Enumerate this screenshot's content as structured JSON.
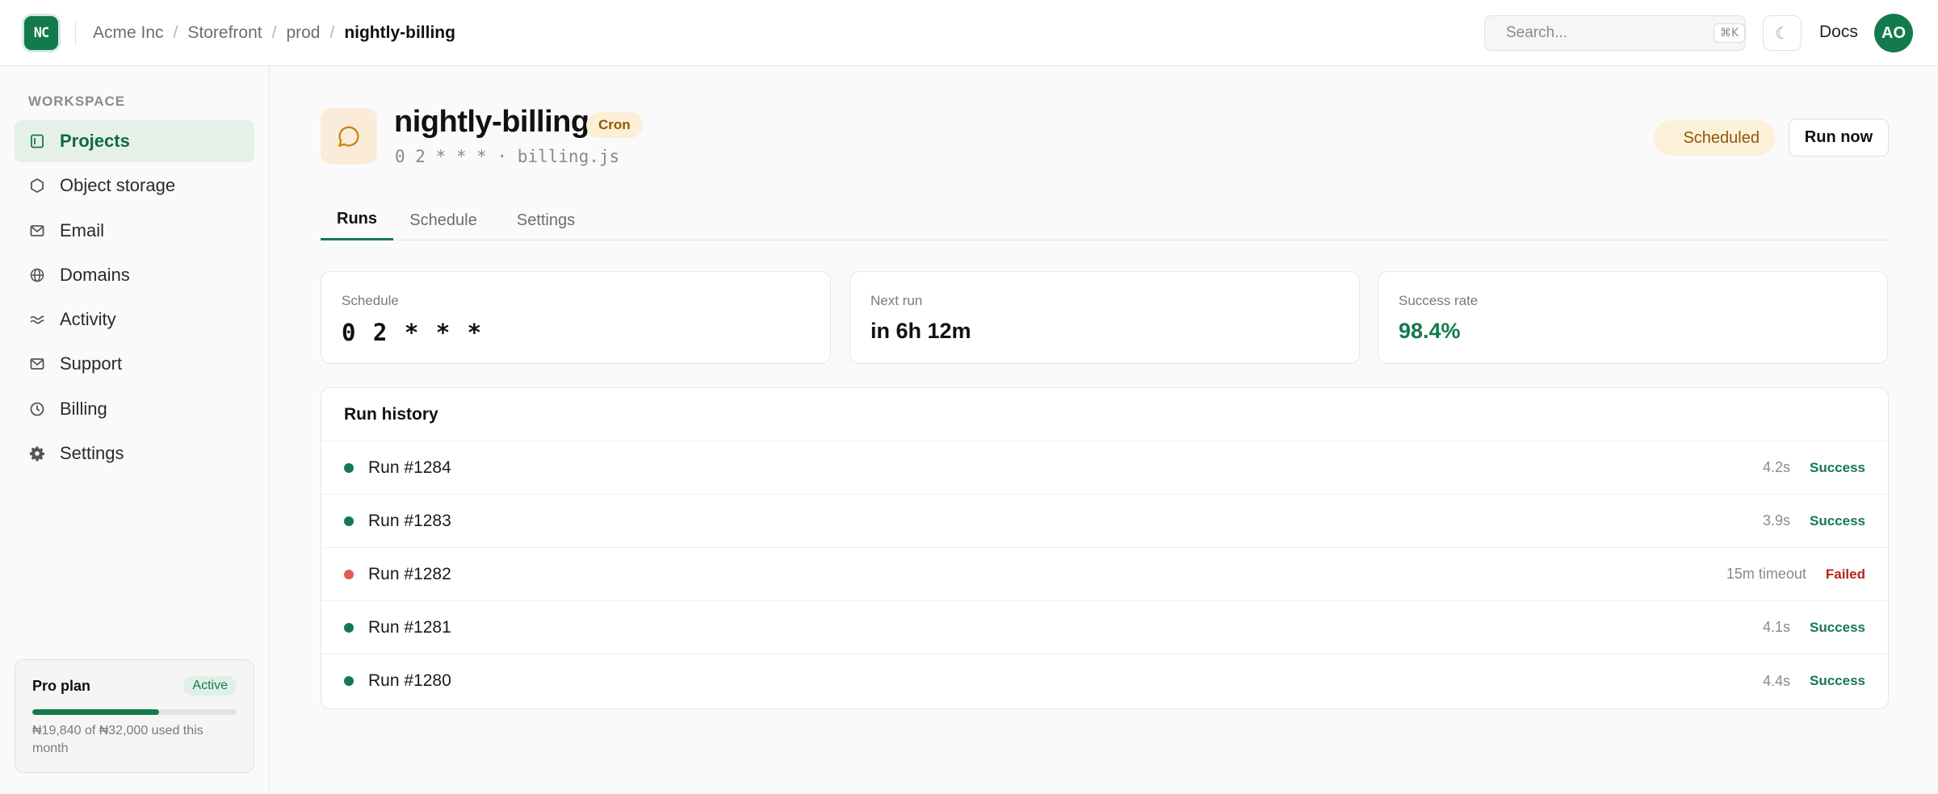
{
  "app": {
    "logo_text": "NC",
    "breadcrumb": [
      "Acme Inc",
      "Storefront",
      "prod"
    ],
    "breadcrumb_current": "nightly-billing",
    "search_placeholder": "Search...",
    "search_shortcut": "⌘K",
    "theme_icon": "☾",
    "docs_label": "Docs",
    "avatar_initials": "AO"
  },
  "sidebar": {
    "heading": "WORKSPACE",
    "items": [
      {
        "label": "Projects",
        "icon": "projects-icon",
        "active": true
      },
      {
        "label": "Object storage",
        "icon": "hexagon-icon",
        "active": false
      },
      {
        "label": "Email",
        "icon": "mail-icon",
        "active": false
      },
      {
        "label": "Domains",
        "icon": "globe-icon",
        "active": false
      },
      {
        "label": "Activity",
        "icon": "activity-wave-icon",
        "active": false
      },
      {
        "label": "Support",
        "icon": "mail-icon",
        "active": false
      },
      {
        "label": "Billing",
        "icon": "clock-icon",
        "active": false
      },
      {
        "label": "Settings",
        "icon": "gear-icon",
        "active": false
      }
    ],
    "plan": {
      "name": "Pro plan",
      "badge": "Active",
      "usage_fraction": 0.62,
      "usage_text": "₦19,840 of ₦32,000 used this month"
    }
  },
  "job": {
    "title": "nightly-billing",
    "type_badge": "Cron",
    "subtitle": "0 2 * * * · billing.js",
    "status": "Scheduled",
    "run_now_label": "Run now",
    "icon": "chat-bubble-icon"
  },
  "tabs": [
    "Runs",
    "Schedule",
    "Settings"
  ],
  "active_tab": "Runs",
  "stats": [
    {
      "label": "Schedule",
      "value": "0 2 * * *",
      "style": "mono"
    },
    {
      "label": "Next run",
      "value": "in 6h 12m",
      "style": "plain"
    },
    {
      "label": "Success rate",
      "value": "98.4%",
      "style": "green"
    }
  ],
  "history": {
    "title": "Run history",
    "runs": [
      {
        "name": "Run #1284",
        "duration": "4.2s",
        "status": "Success"
      },
      {
        "name": "Run #1283",
        "duration": "3.9s",
        "status": "Success"
      },
      {
        "name": "Run #1282",
        "duration": "15m timeout",
        "status": "Failed"
      },
      {
        "name": "Run #1281",
        "duration": "4.1s",
        "status": "Success"
      },
      {
        "name": "Run #1280",
        "duration": "4.4s",
        "status": "Success"
      }
    ]
  },
  "colors": {
    "accent": "#137a4e",
    "success": "#137a4e",
    "failed": "#b3261e",
    "failed_dot": "#e05a5a",
    "warning_bg": "#fcefd7"
  }
}
